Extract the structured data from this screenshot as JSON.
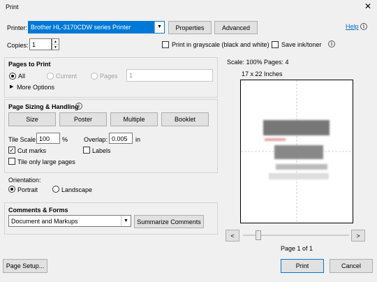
{
  "window": {
    "title": "Print",
    "close_glyph": "✕"
  },
  "printer": {
    "label": "Printer:",
    "selected": "Brother HL-3170CDW series Printer",
    "properties_button": "Properties",
    "advanced_button": "Advanced",
    "help_link": "Help"
  },
  "copies": {
    "label": "Copies:",
    "value": "1"
  },
  "options": {
    "grayscale_label": "Print in grayscale (black and white)",
    "grayscale_checked": false,
    "save_ink_label": "Save ink/toner",
    "save_ink_checked": false
  },
  "pages_to_print": {
    "title": "Pages to Print",
    "all_label": "All",
    "current_label": "Current",
    "pages_label": "Pages",
    "pages_value": "1",
    "more_options": "More Options",
    "selected": "All"
  },
  "page_sizing": {
    "title": "Page Sizing & Handling",
    "buttons": [
      "Size",
      "Poster",
      "Multiple",
      "Booklet"
    ],
    "tile_scale_label": "Tile Scale:",
    "tile_scale_value": "100",
    "tile_scale_unit": "%",
    "overlap_label": "Overlap:",
    "overlap_value": "0.005",
    "overlap_unit": "in",
    "cut_marks_label": "Cut marks",
    "cut_marks_checked": true,
    "labels_label": "Labels",
    "labels_checked": false,
    "tile_large_label": "Tile only large pages",
    "tile_large_checked": false
  },
  "orientation": {
    "title": "Orientation:",
    "portrait_label": "Portrait",
    "landscape_label": "Landscape",
    "selected": "Portrait"
  },
  "comments_forms": {
    "title": "Comments & Forms",
    "selected": "Document and Markups",
    "summarize_button": "Summarize Comments"
  },
  "preview": {
    "scale_text": "Scale: 100% Pages: 4",
    "page_size": "17 x 22 Inches",
    "prev_glyph": "<",
    "next_glyph": ">",
    "page_indicator": "Page 1 of 1"
  },
  "footer": {
    "page_setup_button": "Page Setup...",
    "print_button": "Print",
    "cancel_button": "Cancel"
  }
}
